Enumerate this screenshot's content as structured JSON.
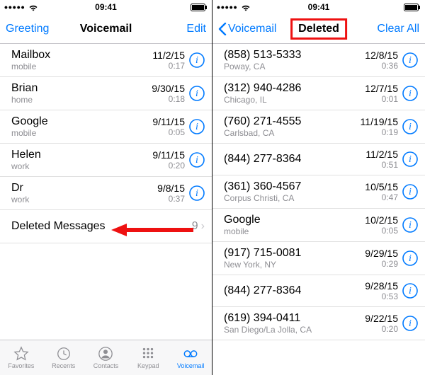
{
  "left": {
    "status": {
      "dots": "•••••",
      "time": "09:41"
    },
    "nav": {
      "left": "Greeting",
      "title": "Voicemail",
      "right": "Edit"
    },
    "items": [
      {
        "name": "Mailbox",
        "sub": "mobile",
        "date": "11/2/15",
        "time": "0:17"
      },
      {
        "name": "Brian",
        "sub": "home",
        "date": "9/30/15",
        "time": "0:18"
      },
      {
        "name": "Google",
        "sub": "mobile",
        "date": "9/11/15",
        "time": "0:05"
      },
      {
        "name": "Helen",
        "sub": "work",
        "date": "9/11/15",
        "time": "0:20"
      },
      {
        "name": "Dr",
        "sub": "work",
        "date": "9/8/15",
        "time": "0:37"
      }
    ],
    "deleted": {
      "label": "Deleted Messages",
      "count": "9"
    }
  },
  "right": {
    "status": {
      "dots": "•••••",
      "time": "09:41"
    },
    "nav": {
      "left": "Voicemail",
      "title": "Deleted",
      "right": "Clear All"
    },
    "items": [
      {
        "name": "(858) 513-5333",
        "sub": "Poway, CA",
        "date": "12/8/15",
        "time": "0:36"
      },
      {
        "name": "(312) 940-4286",
        "sub": "Chicago, IL",
        "date": "12/7/15",
        "time": "0:01"
      },
      {
        "name": "(760) 271-4555",
        "sub": "Carlsbad, CA",
        "date": "11/19/15",
        "time": "0:19"
      },
      {
        "name": "(844) 277-8364",
        "sub": "",
        "date": "11/2/15",
        "time": "0:51"
      },
      {
        "name": "(361) 360-4567",
        "sub": "Corpus Christi, CA",
        "date": "10/5/15",
        "time": "0:47"
      },
      {
        "name": "Google",
        "sub": "mobile",
        "date": "10/2/15",
        "time": "0:05"
      },
      {
        "name": "(917) 715-0081",
        "sub": "New York, NY",
        "date": "9/29/15",
        "time": "0:29"
      },
      {
        "name": "(844) 277-8364",
        "sub": "",
        "date": "9/28/15",
        "time": "0:53"
      },
      {
        "name": "(619) 394-0411",
        "sub": "San Diego/La Jolla, CA",
        "date": "9/22/15",
        "time": "0:20"
      }
    ]
  },
  "tabs": {
    "favorites": "Favorites",
    "recents": "Recents",
    "contacts": "Contacts",
    "keypad": "Keypad",
    "voicemail": "Voicemail"
  }
}
